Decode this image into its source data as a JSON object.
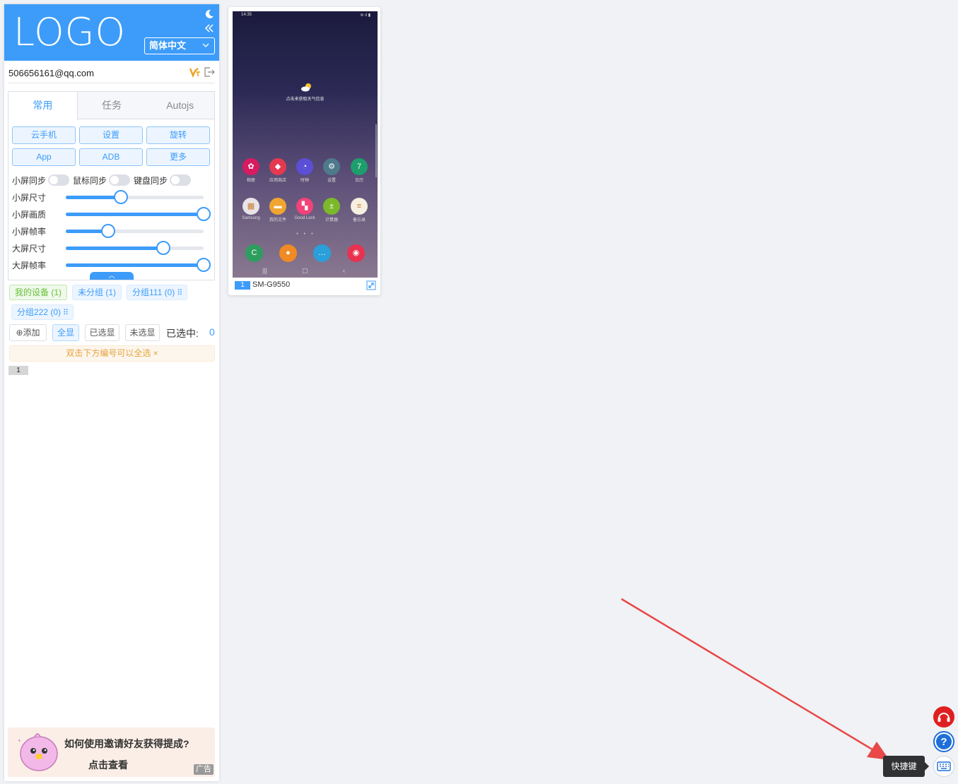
{
  "header": {
    "logo": "LOGO",
    "language": "简体中文"
  },
  "user": {
    "email": "506656161@qq.com"
  },
  "tabs": [
    {
      "label": "常用",
      "active": true
    },
    {
      "label": "任务",
      "active": false
    },
    {
      "label": "Autojs",
      "active": false
    }
  ],
  "buttons": [
    "云手机",
    "设置",
    "旋转",
    "App",
    "ADB",
    "更多"
  ],
  "sync": [
    {
      "label": "小屏同步",
      "on": false
    },
    {
      "label": "鼠标同步",
      "on": false
    },
    {
      "label": "键盘同步",
      "on": false
    }
  ],
  "sliders": [
    {
      "label": "小屏尺寸",
      "value": 0.4
    },
    {
      "label": "小屏画质",
      "value": 1.0
    },
    {
      "label": "小屏帧率",
      "value": 0.31
    },
    {
      "label": "大屏尺寸",
      "value": 0.71
    },
    {
      "label": "大屏帧率",
      "value": 1.0
    }
  ],
  "groups": [
    {
      "label": "我的设备 (1)"
    },
    {
      "label": "未分组 (1)"
    },
    {
      "label": "分组111 (0)"
    },
    {
      "label": "分组222 (0)"
    }
  ],
  "actions": {
    "add": "添加",
    "show_all": "全显",
    "show_selected": "已选显",
    "show_unselected": "未选显",
    "selected_label": "已选中:",
    "selected_count": "0"
  },
  "hint": "双击下方编号可以全选",
  "device_list_number": "1",
  "ad": {
    "title": "如何使用邀请好友获得提成?",
    "cta": "点击查看",
    "badge": "广告"
  },
  "device": {
    "index": "1",
    "model": "SM-G9550",
    "screen": {
      "time": "14:35",
      "weather": "点击来获取天气信息",
      "apps_row1": [
        {
          "name": "相册",
          "color": "#d81b60",
          "glyph": "✿"
        },
        {
          "name": "应用商店",
          "color": "#e53950",
          "glyph": "◆"
        },
        {
          "name": "时钟",
          "color": "#5b4fd6",
          "glyph": "◔"
        },
        {
          "name": "设置",
          "color": "#4e7a8c",
          "glyph": "⚙"
        },
        {
          "name": "日历",
          "color": "#1e9e6c",
          "glyph": "7"
        }
      ],
      "apps_row2": [
        {
          "name": "Samsung",
          "color": "#e9e3e8",
          "glyph": "▦"
        },
        {
          "name": "我的文件",
          "color": "#f0a531",
          "glyph": "▬"
        },
        {
          "name": "Good Lock",
          "color": "#f3427a",
          "glyph": "▚"
        },
        {
          "name": "计算器",
          "color": "#7bb82a",
          "glyph": "±"
        },
        {
          "name": "备忘录",
          "color": "#f6efe2",
          "glyph": "≡"
        }
      ],
      "dock": [
        {
          "name": "phone",
          "color": "#2e9e5e",
          "glyph": "C"
        },
        {
          "name": "contacts",
          "color": "#f08a24",
          "glyph": "●"
        },
        {
          "name": "messages",
          "color": "#2b9fd9",
          "glyph": "…"
        },
        {
          "name": "camera",
          "color": "#e8324f",
          "glyph": "◉"
        }
      ]
    }
  },
  "tooltip": "快捷键",
  "colors": {
    "primary": "#3d9cf9",
    "support": "#e02020",
    "help": "#1e6fd9",
    "arrow": "#e84848"
  }
}
